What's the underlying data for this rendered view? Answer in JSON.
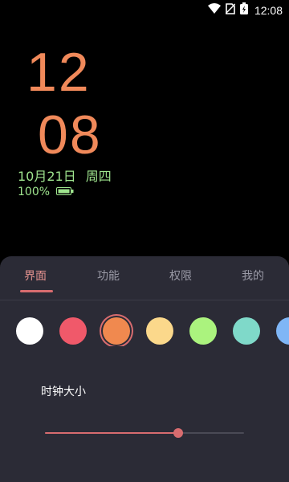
{
  "status_bar": {
    "time": "12:08"
  },
  "clock": {
    "hour": "12",
    "minute": "08",
    "date": "10月21日",
    "weekday": "周四",
    "battery": "100%"
  },
  "tabs": [
    {
      "label": "界面",
      "active": true
    },
    {
      "label": "功能",
      "active": false
    },
    {
      "label": "权限",
      "active": false
    },
    {
      "label": "我的",
      "active": false
    }
  ],
  "colors": {
    "clock": "#f0895a",
    "date": "#9fe58e",
    "accent": "#d86c6f",
    "sheet": "#2b2b36",
    "swatches": [
      "#ffffff",
      "#f0596a",
      "#f0894f",
      "#fbd88b",
      "#abf37e",
      "#7fd9c9",
      "#7fb6f6"
    ],
    "selected_swatch": 2
  },
  "settings": {
    "clock_size_label": "时钟大小",
    "clock_size_value": 0.67
  }
}
